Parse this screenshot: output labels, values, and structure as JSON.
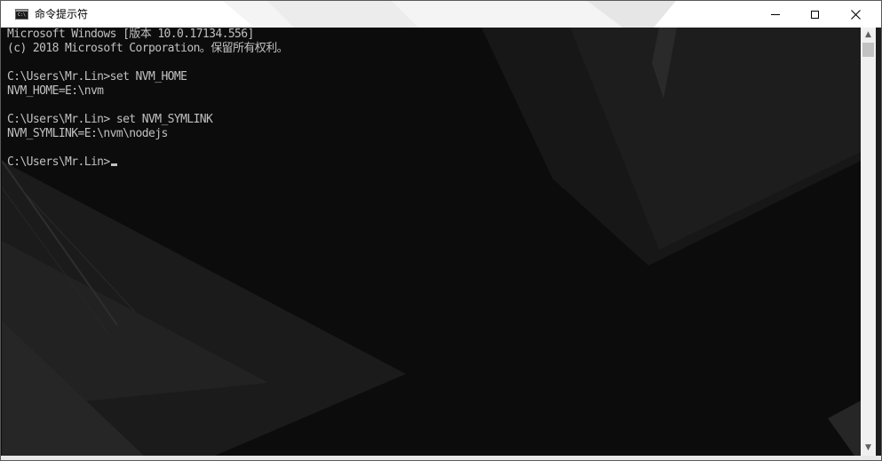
{
  "window": {
    "title": "命令提示符",
    "icon": "cmd-icon",
    "icon_text": "C:\\",
    "controls": {
      "minimize": "minimize-icon",
      "maximize": "maximize-icon",
      "close": "close-icon"
    }
  },
  "console": {
    "lines": [
      "Microsoft Windows [版本 10.0.17134.556]",
      "(c) 2018 Microsoft Corporation。保留所有权利。",
      "",
      "C:\\Users\\Mr.Lin>set NVM_HOME",
      "NVM_HOME=E:\\nvm",
      "",
      "C:\\Users\\Mr.Lin> set NVM_SYMLINK",
      "NVM_SYMLINK=E:\\nvm\\nodejs",
      "",
      "C:\\Users\\Mr.Lin>"
    ],
    "text_color": "#c0c0c0",
    "background_color": "#0c0c0c"
  },
  "scrollbar": {
    "up_icon": "scroll-up-arrow-icon",
    "down_icon": "scroll-down-arrow-icon",
    "up_glyph": "▲",
    "down_glyph": "▼"
  }
}
